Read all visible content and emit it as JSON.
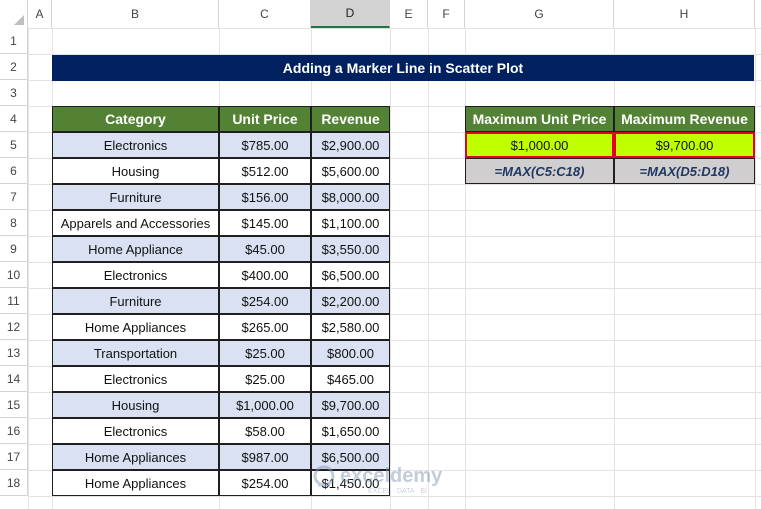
{
  "columns": [
    "A",
    "B",
    "C",
    "D",
    "E",
    "F",
    "G",
    "H"
  ],
  "selected_column": "D",
  "rows": [
    "1",
    "2",
    "3",
    "4",
    "5",
    "6",
    "7",
    "8",
    "9",
    "10",
    "11",
    "12",
    "13",
    "14",
    "15",
    "16",
    "17",
    "18"
  ],
  "title": "Adding a Marker Line in Scatter Plot",
  "table": {
    "headers": [
      "Category",
      "Unit Price",
      "Revenue"
    ],
    "rows": [
      {
        "category": "Electronics",
        "unit_price": "$785.00",
        "revenue": "$2,900.00"
      },
      {
        "category": "Housing",
        "unit_price": "$512.00",
        "revenue": "$5,600.00"
      },
      {
        "category": "Furniture",
        "unit_price": "$156.00",
        "revenue": "$8,000.00"
      },
      {
        "category": "Apparels and Accessories",
        "unit_price": "$145.00",
        "revenue": "$1,100.00"
      },
      {
        "category": "Home Appliance",
        "unit_price": "$45.00",
        "revenue": "$3,550.00"
      },
      {
        "category": "Electronics",
        "unit_price": "$400.00",
        "revenue": "$6,500.00"
      },
      {
        "category": "Furniture",
        "unit_price": "$254.00",
        "revenue": "$2,200.00"
      },
      {
        "category": "Home Appliances",
        "unit_price": "$265.00",
        "revenue": "$2,580.00"
      },
      {
        "category": "Transportation",
        "unit_price": "$25.00",
        "revenue": "$800.00"
      },
      {
        "category": "Electronics",
        "unit_price": "$25.00",
        "revenue": "$465.00"
      },
      {
        "category": "Housing",
        "unit_price": "$1,000.00",
        "revenue": "$9,700.00"
      },
      {
        "category": "Electronics",
        "unit_price": "$58.00",
        "revenue": "$1,650.00"
      },
      {
        "category": "Home Appliances",
        "unit_price": "$987.00",
        "revenue": "$6,500.00"
      },
      {
        "category": "Home Appliances",
        "unit_price": "$254.00",
        "revenue": "$1,450.00"
      }
    ]
  },
  "results": {
    "headers": [
      "Maximum Unit Price",
      "Maximum Revenue"
    ],
    "values": [
      "$1,000.00",
      "$9,700.00"
    ],
    "formulas": [
      "=MAX(C5:C18)",
      "=MAX(D5:D18)"
    ]
  },
  "watermark": {
    "brand": "exceldemy",
    "tagline": "EXCEL · DATA · BI"
  }
}
